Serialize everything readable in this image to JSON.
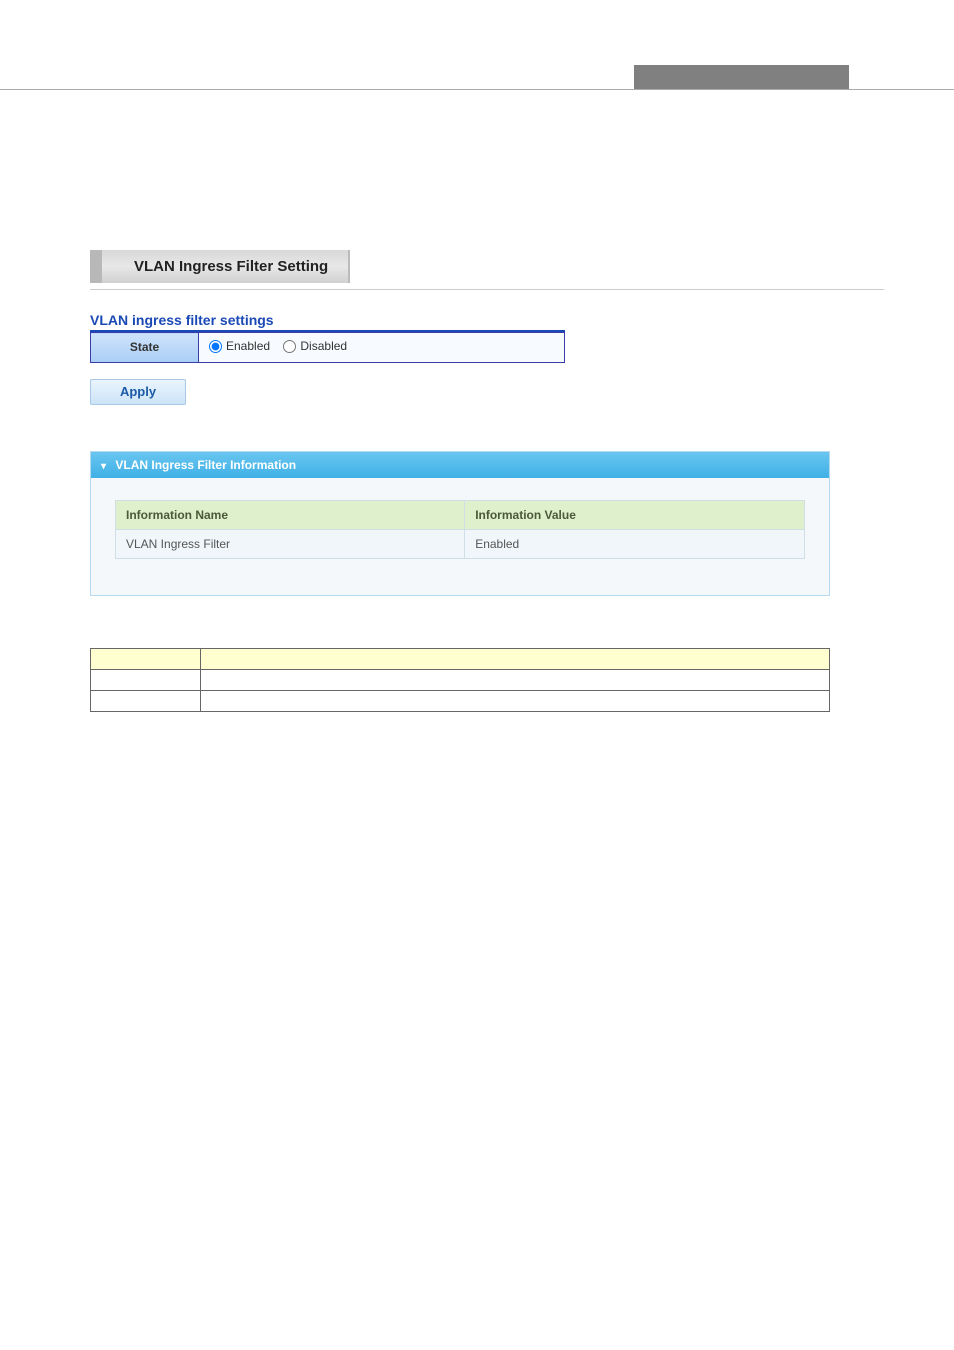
{
  "section_title": "VLAN Ingress Filter Setting",
  "settings": {
    "heading": "VLAN ingress filter settings",
    "state_label": "State",
    "enabled_label": "Enabled",
    "disabled_label": "Disabled",
    "state_value": "enabled",
    "apply_label": "Apply"
  },
  "info_panel": {
    "header": "VLAN Ingress Filter Information",
    "columns": {
      "name": "Information Name",
      "value": "Information Value"
    },
    "rows": [
      {
        "name": "VLAN Ingress Filter",
        "value": "Enabled"
      }
    ]
  },
  "desc_table": {
    "col1_header": "",
    "col2_header": "",
    "rows": [
      {
        "c1": "",
        "c2": ""
      },
      {
        "c1": "",
        "c2": ""
      }
    ]
  }
}
